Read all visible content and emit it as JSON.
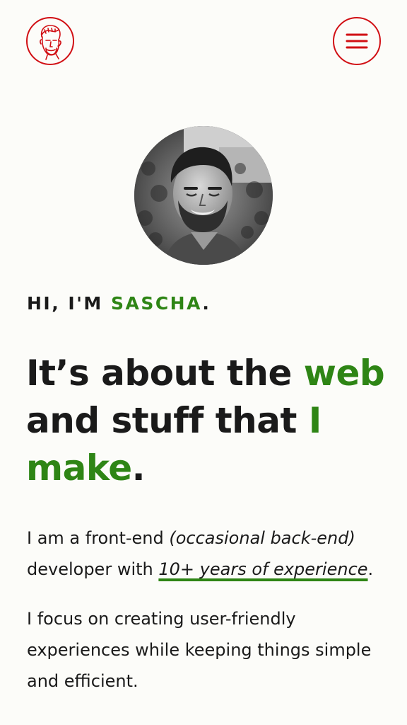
{
  "header": {
    "logo_alt": "Sascha logo",
    "menu_label": "Menu"
  },
  "hero": {
    "avatar_alt": "Portrait of Sascha",
    "greeting": {
      "prefix": "HI, I'M ",
      "name": "SASCHA",
      "suffix": "."
    },
    "headline": {
      "part1": "It’s about the ",
      "accent1": "web",
      "part2": " and stuff that ",
      "accent2": "I make",
      "part3": "."
    }
  },
  "intro": {
    "p1_start": "I am a front-end ",
    "p1_italic": "(occasional back-end)",
    "p1_middle": " developer with ",
    "p1_link": "10+ years of experience",
    "p1_end": ".",
    "p2": "I focus on creating user-friendly experiences while keeping things simple and efficient."
  },
  "colors": {
    "accent_green": "#2e8515",
    "brand_red": "#d10f14",
    "background": "#fcfcf9",
    "text": "#1a1a1a"
  },
  "icons": {
    "logo": "face-sketch-icon",
    "menu": "hamburger-menu-icon"
  }
}
